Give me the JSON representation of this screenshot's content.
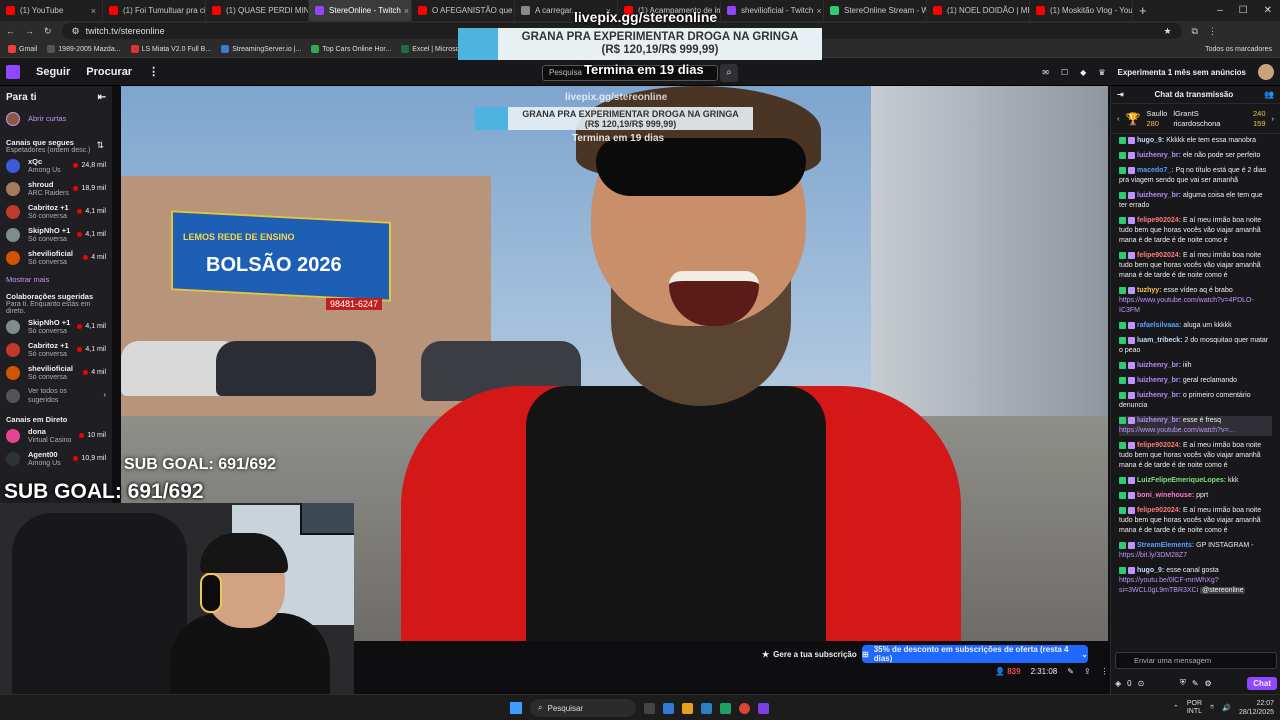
{
  "browser": {
    "tabs": [
      {
        "title": "(1) YouTube",
        "color": "#ff0000"
      },
      {
        "title": "(1) Foi Tumultuar pra cim",
        "color": "#ff0000"
      },
      {
        "title": "(1) QUASE PERDI MINHA",
        "color": "#ff0000"
      },
      {
        "title": "StereOnline - Twitch",
        "color": "#9147ff",
        "active": true
      },
      {
        "title": "O AFEGANISTÃO que nin",
        "color": "#ff0000"
      },
      {
        "title": "A carregar...",
        "color": "#888888"
      },
      {
        "title": "(1) Acampamento de imi",
        "color": "#ff0000"
      },
      {
        "title": "shevilioficial - Twitch",
        "color": "#9147ff"
      },
      {
        "title": "StereOnline Stream - Wat",
        "color": "#2ecc71"
      },
      {
        "title": "(1) NOEL DOIDÃO | MER",
        "color": "#ff0000"
      },
      {
        "title": "(1) Moskitão Vlog - YouTu",
        "color": "#ff0000"
      }
    ],
    "new_tab": "+",
    "url": "twitch.tv/stereonline",
    "bookmarks": [
      {
        "label": "Gmail",
        "color": "#ea4335"
      },
      {
        "label": "1989-2005 Mazda...",
        "color": "#555555"
      },
      {
        "label": "LS Miata V2.0 Full B...",
        "color": "#d33"
      },
      {
        "label": "StreamingServer.io |...",
        "color": "#3a7bd5"
      },
      {
        "label": "Top Cars Online Hor...",
        "color": "#34a853"
      },
      {
        "label": "Excel | Microsoft 365",
        "color": "#1d6f42"
      }
    ],
    "all_bookmarks": "Todos os marcadores"
  },
  "twitch_nav": {
    "follow": "Seguir",
    "browse": "Procurar",
    "search_placeholder": "Pesquisa",
    "prime_promo": "Experimenta 1 mês sem anúncios"
  },
  "sidebar": {
    "title": "Para ti",
    "shorts": "Abrir curtas",
    "followed_title": "Canais que segues",
    "followed_sub": "Espetadores (ordem desc.)",
    "followed": [
      {
        "name": "xQc",
        "game": "Among Us",
        "viewers": "24,8 mil",
        "color": "#3b5bdb"
      },
      {
        "name": "shroud",
        "game": "ARC Raiders",
        "viewers": "18,9 mil",
        "color": "#a37c5c"
      },
      {
        "name": "Cabritoz +1",
        "game": "Só conversa",
        "viewers": "4,1 mil",
        "color": "#c0392b"
      },
      {
        "name": "SkipNhO +1",
        "game": "Só conversa",
        "viewers": "4,1 mil",
        "color": "#7f8c8d"
      },
      {
        "name": "shevilioficial",
        "game": "Só conversa",
        "viewers": "4 mil",
        "color": "#d35400"
      }
    ],
    "show_more": "Mostrar mais",
    "collab_title": "Colaborações sugeridas",
    "collab_sub": "Para ti. Enquanto estás em direto.",
    "collabs": [
      {
        "name": "SkipNhO +1",
        "game": "Só conversa",
        "viewers": "4,1 mil",
        "color": "#7f8c8d"
      },
      {
        "name": "Cabritoz +1",
        "game": "Só conversa",
        "viewers": "4,1 mil",
        "color": "#c0392b"
      },
      {
        "name": "shevilioficial",
        "game": "Só conversa",
        "viewers": "4 mil",
        "color": "#d35400"
      }
    ],
    "see_all": "Ver todos os sugeridos",
    "live_title": "Canais em Direto",
    "live": [
      {
        "name": "dona",
        "game": "Virtual Casino",
        "viewers": "10 mil",
        "color": "#e84393"
      },
      {
        "name": "Agent00",
        "game": "Among Us",
        "viewers": "10,9 mil",
        "color": "#2d3436"
      }
    ]
  },
  "overlay": {
    "url": "livepix.gg/stereonline",
    "banner_line1": "GRANA PRA EXPERIMENTAR DROGA NA GRINGA",
    "banner_line2": "(R$ 120,19/R$ 999,99)",
    "timer": "Termina em 19 dias",
    "sub_goal": "SUB GOAL: 691/692"
  },
  "video_scene": {
    "billboard_line1": "LEMOS REDE DE ENSINO",
    "billboard_line2": "BOLSÃO 2026",
    "billboard_phone": "98481-6247"
  },
  "below_video": {
    "sub_button": "Gere a tua subscrição",
    "discount_button": "35% de desconto em subscrições de oferta (resta 4 dias)",
    "viewers": "839",
    "uptime": "2:31:08"
  },
  "chat": {
    "title": "Chat da transmissão",
    "leaderboard": [
      {
        "name": "Saullo",
        "value": "280"
      },
      {
        "name": "lGrantS",
        "value": "240"
      },
      {
        "name": "ricardoschona",
        "value": "159"
      }
    ],
    "messages": [
      {
        "user": "hugo_9:",
        "text": "Kkkkk ele tem essa manobra",
        "color": "#c0d8ff"
      },
      {
        "user": "luizhenry_br:",
        "text": "ele não pode ser perfeito",
        "color": "#b78cff"
      },
      {
        "user": "macedo7_:",
        "text": "Pq no título está que é 2 dias pra viagem sendo que vai ser amanhã",
        "color": "#5aa0ff"
      },
      {
        "user": "luizhenry_br:",
        "text": "alguma coisa ele tem que ter errado",
        "color": "#b78cff"
      },
      {
        "user": "felipe902024:",
        "text": "E aí meu irmão boa noite tudo bem que horas vocês vão viajar amanhã mana é de tarde é de noite como é",
        "color": "#ff7a7a"
      },
      {
        "user": "felipe902024:",
        "text": "E aí meu irmão boa noite tudo bem que horas vocês vão viajar amanhã mana é de tarde é de noite como é",
        "color": "#ff7a7a"
      },
      {
        "user": "tuzhyy:",
        "text": "esse vídeo aq é brabo",
        "link": "https://www.youtube.com/watch?v=4PDLO-IC3FM",
        "color": "#ffc24a"
      },
      {
        "user": "rafaelsilvaaa:",
        "text": "aluga um kkkkk",
        "color": "#5aa0ff"
      },
      {
        "user": "luam_tribeck:",
        "text": "2 do mosquitao quer matar o peao",
        "color": "#c0d8ff"
      },
      {
        "user": "luizhenry_br:",
        "text": "iiih",
        "color": "#b78cff"
      },
      {
        "user": "luizhenry_br:",
        "text": "geral reclamando",
        "color": "#b78cff"
      },
      {
        "user": "luizhenry_br:",
        "text": "o primeiro comentário denuncia",
        "color": "#b78cff"
      },
      {
        "user": "luizhenry_br:",
        "text": "esse é fresq",
        "link": "https://www.youtube.com/watch?v=...",
        "color": "#b78cff",
        "highlight": true
      },
      {
        "user": "felipe902024:",
        "text": "E aí meu irmão boa noite tudo bem que horas vocês vão viajar amanhã mana é de tarde é de noite como é",
        "color": "#ff7a7a"
      },
      {
        "user": "LuizFelipeEmeriqueLopes:",
        "text": "kkk",
        "color": "#7ee07e"
      },
      {
        "user": "boni_winehouse:",
        "text": "pprt",
        "color": "#ff7ad0"
      },
      {
        "user": "felipe902024:",
        "text": "E aí meu irmão boa noite tudo bem que horas vocês vão viajar amanhã mana é de tarde é de noite como é",
        "color": "#ff7a7a"
      },
      {
        "user": "StreamElements:",
        "text": "GP INSTAGRAM -",
        "link": "https://bit.ly/3DM28Z7",
        "color": "#5aa0ff"
      },
      {
        "user": "hugo_9:",
        "text": "esse canal gosta",
        "link": "https://youtu.be/0lCF-mnWhXg?si=3WCL0gL9mTBR3XCi",
        "mention": "@stereonline",
        "color": "#c0d8ff"
      }
    ],
    "input_placeholder": "Enviar uma mensagem",
    "points": "0",
    "chat_button": "Chat"
  },
  "taskbar": {
    "search": "Pesquisar",
    "lang": "POR",
    "region": "INTL",
    "time": "22:07",
    "date": "28/12/2025"
  }
}
